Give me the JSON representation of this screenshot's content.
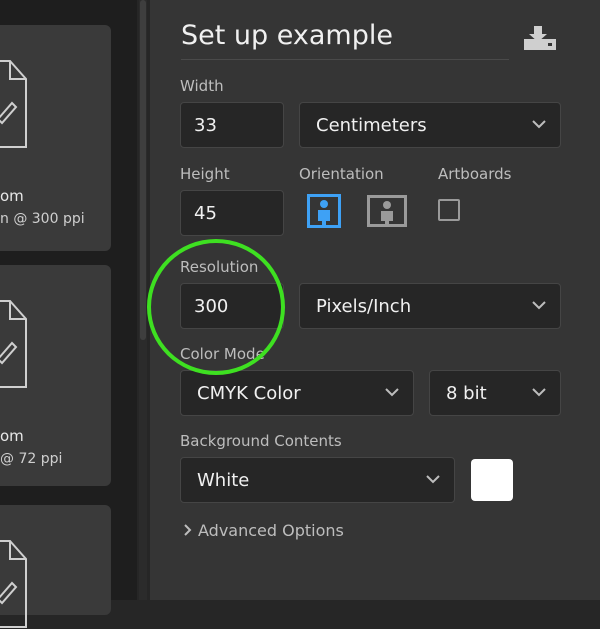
{
  "presets": [
    {
      "title": "om",
      "subtitle": "n @ 300 ppi"
    },
    {
      "title": "om",
      "subtitle": "@ 72 ppi"
    },
    {
      "title": "",
      "subtitle": ""
    }
  ],
  "panel": {
    "title": "Set up example",
    "width": {
      "label": "Width",
      "value": "33",
      "unit": "Centimeters"
    },
    "height": {
      "label": "Height",
      "value": "45"
    },
    "orientation": {
      "label": "Orientation",
      "selected": "portrait"
    },
    "artboards": {
      "label": "Artboards",
      "checked": false
    },
    "resolution": {
      "label": "Resolution",
      "value": "300",
      "unit": "Pixels/Inch"
    },
    "color_mode": {
      "label": "Color Mode",
      "mode": "CMYK Color",
      "depth": "8 bit"
    },
    "background": {
      "label": "Background Contents",
      "value": "White",
      "swatch_color": "#ffffff"
    },
    "advanced": {
      "label": "Advanced Options"
    }
  },
  "colors": {
    "accent": "#3ea1f5",
    "highlight": "#3ee021"
  }
}
